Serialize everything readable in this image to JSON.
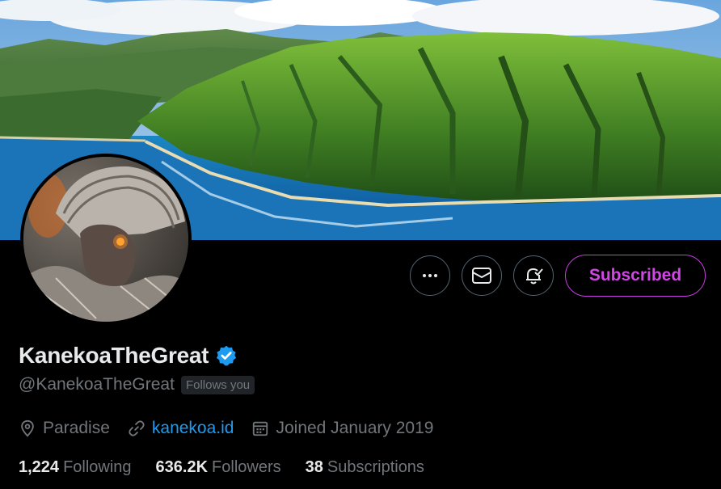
{
  "profile": {
    "display_name": "KanekoaTheGreat",
    "handle": "@KanekoaTheGreat",
    "follows_you_badge": "Follows you",
    "verified": true,
    "location": "Paradise",
    "website": "kanekoa.id",
    "joined": "Joined January 2019"
  },
  "actions": {
    "more_icon": "more-horizontal-icon",
    "message_icon": "envelope-icon",
    "notify_icon": "bell-check-icon",
    "subscribed_label": "Subscribed"
  },
  "stats": {
    "following_count": "1,224",
    "following_label": "Following",
    "followers_count": "636.2K",
    "followers_label": "Followers",
    "subscriptions_count": "38",
    "subscriptions_label": "Subscriptions"
  },
  "colors": {
    "background": "#000000",
    "text_primary": "#e7e9ea",
    "text_secondary": "#71767b",
    "link": "#1d9bf0",
    "verified_badge": "#1d9bf0",
    "subscribed_accent": "#d245e6",
    "border": "#536471"
  }
}
